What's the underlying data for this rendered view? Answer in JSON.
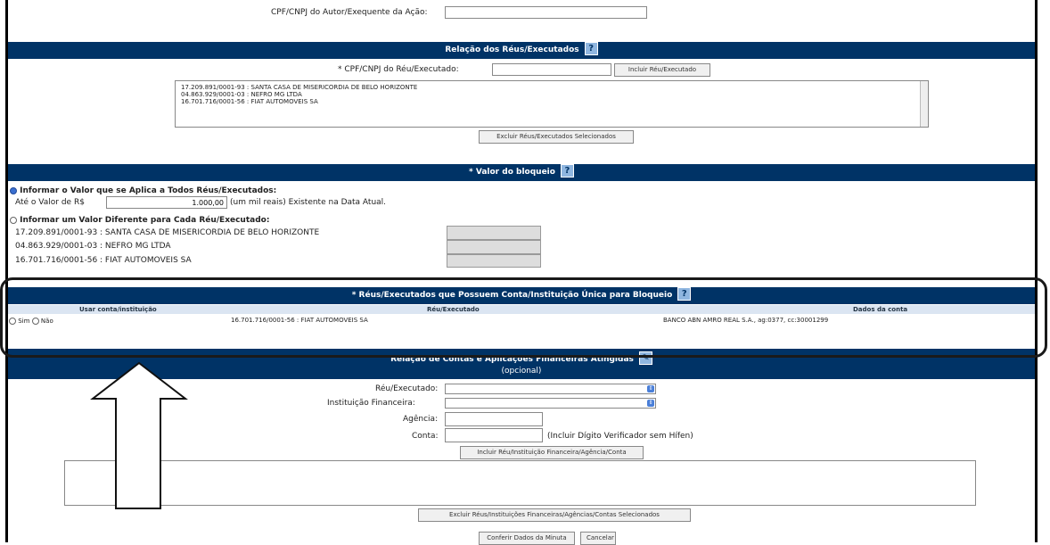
{
  "top": {
    "autor_label": "CPF/CNPJ do Autor/Exequente da Ação:",
    "autor_value": ""
  },
  "reus": {
    "title": "Relação dos Réus/Executados",
    "cpf_label": "* CPF/CNPJ do Réu/Executado:",
    "cpf_value": "",
    "add_button": "Incluir Réu/Executado",
    "list": [
      "17.209.891/0001-93 : SANTA CASA DE MISERICORDIA DE BELO HORIZONTE",
      "04.863.929/0001-03 : NEFRO MG LTDA",
      "16.701.716/0001-56 : FIAT AUTOMOVEIS SA"
    ],
    "remove_button": "Excluir Réus/Executados Selecionados"
  },
  "valor": {
    "title": "* Valor do bloqueio",
    "option_all": "Informar o Valor que se Aplica a Todos Réus/Executados:",
    "ate_label": "Até o Valor de R$",
    "valor_value": "1.000,00",
    "valor_extenso": "(um mil reais)  Existente na Data Atual.",
    "option_each": "Informar um Valor Diferente para Cada Réu/Executado:",
    "rows": [
      {
        "name": "17.209.891/0001-93 : SANTA CASA DE MISERICORDIA DE BELO HORIZONTE",
        "value": ""
      },
      {
        "name": "04.863.929/0001-03 : NEFRO MG LTDA",
        "value": ""
      },
      {
        "name": "16.701.716/0001-56 : FIAT AUTOMOVEIS SA",
        "value": ""
      }
    ]
  },
  "unica": {
    "title": "* Réus/Executados que Possuem Conta/Instituição Única para Bloqueio",
    "col_usar": "Usar conta/instituição",
    "col_reu": "Réu/Executado",
    "col_dados": "Dados da conta",
    "sim": "Sim",
    "nao": "Não",
    "reu": "16.701.716/0001-56 : FIAT AUTOMOVEIS SA",
    "dados": "BANCO ABN AMRO REAL S.A., ag:0377, cc:30001299"
  },
  "contas": {
    "title": "Relação de Contas e Aplicações Financeiras Atingidas",
    "subtitle": "(opcional)",
    "reu_label": "Réu/Executado:",
    "inst_label": "Instituição Financeira:",
    "agencia_label": "Agência:",
    "conta_label": "Conta:",
    "conta_hint": "(Incluir Dígito Verificador sem Hífen)",
    "add_button": "Incluir Réu/Instituição Financeira/Agência/Conta",
    "remove_button": "Excluir Réus/Instituições Financeiras/Agências/Contas Selecionados"
  },
  "footer": {
    "confirm_button": "Conferir Dados da Minuta",
    "cancel_button": "Cancelar"
  }
}
